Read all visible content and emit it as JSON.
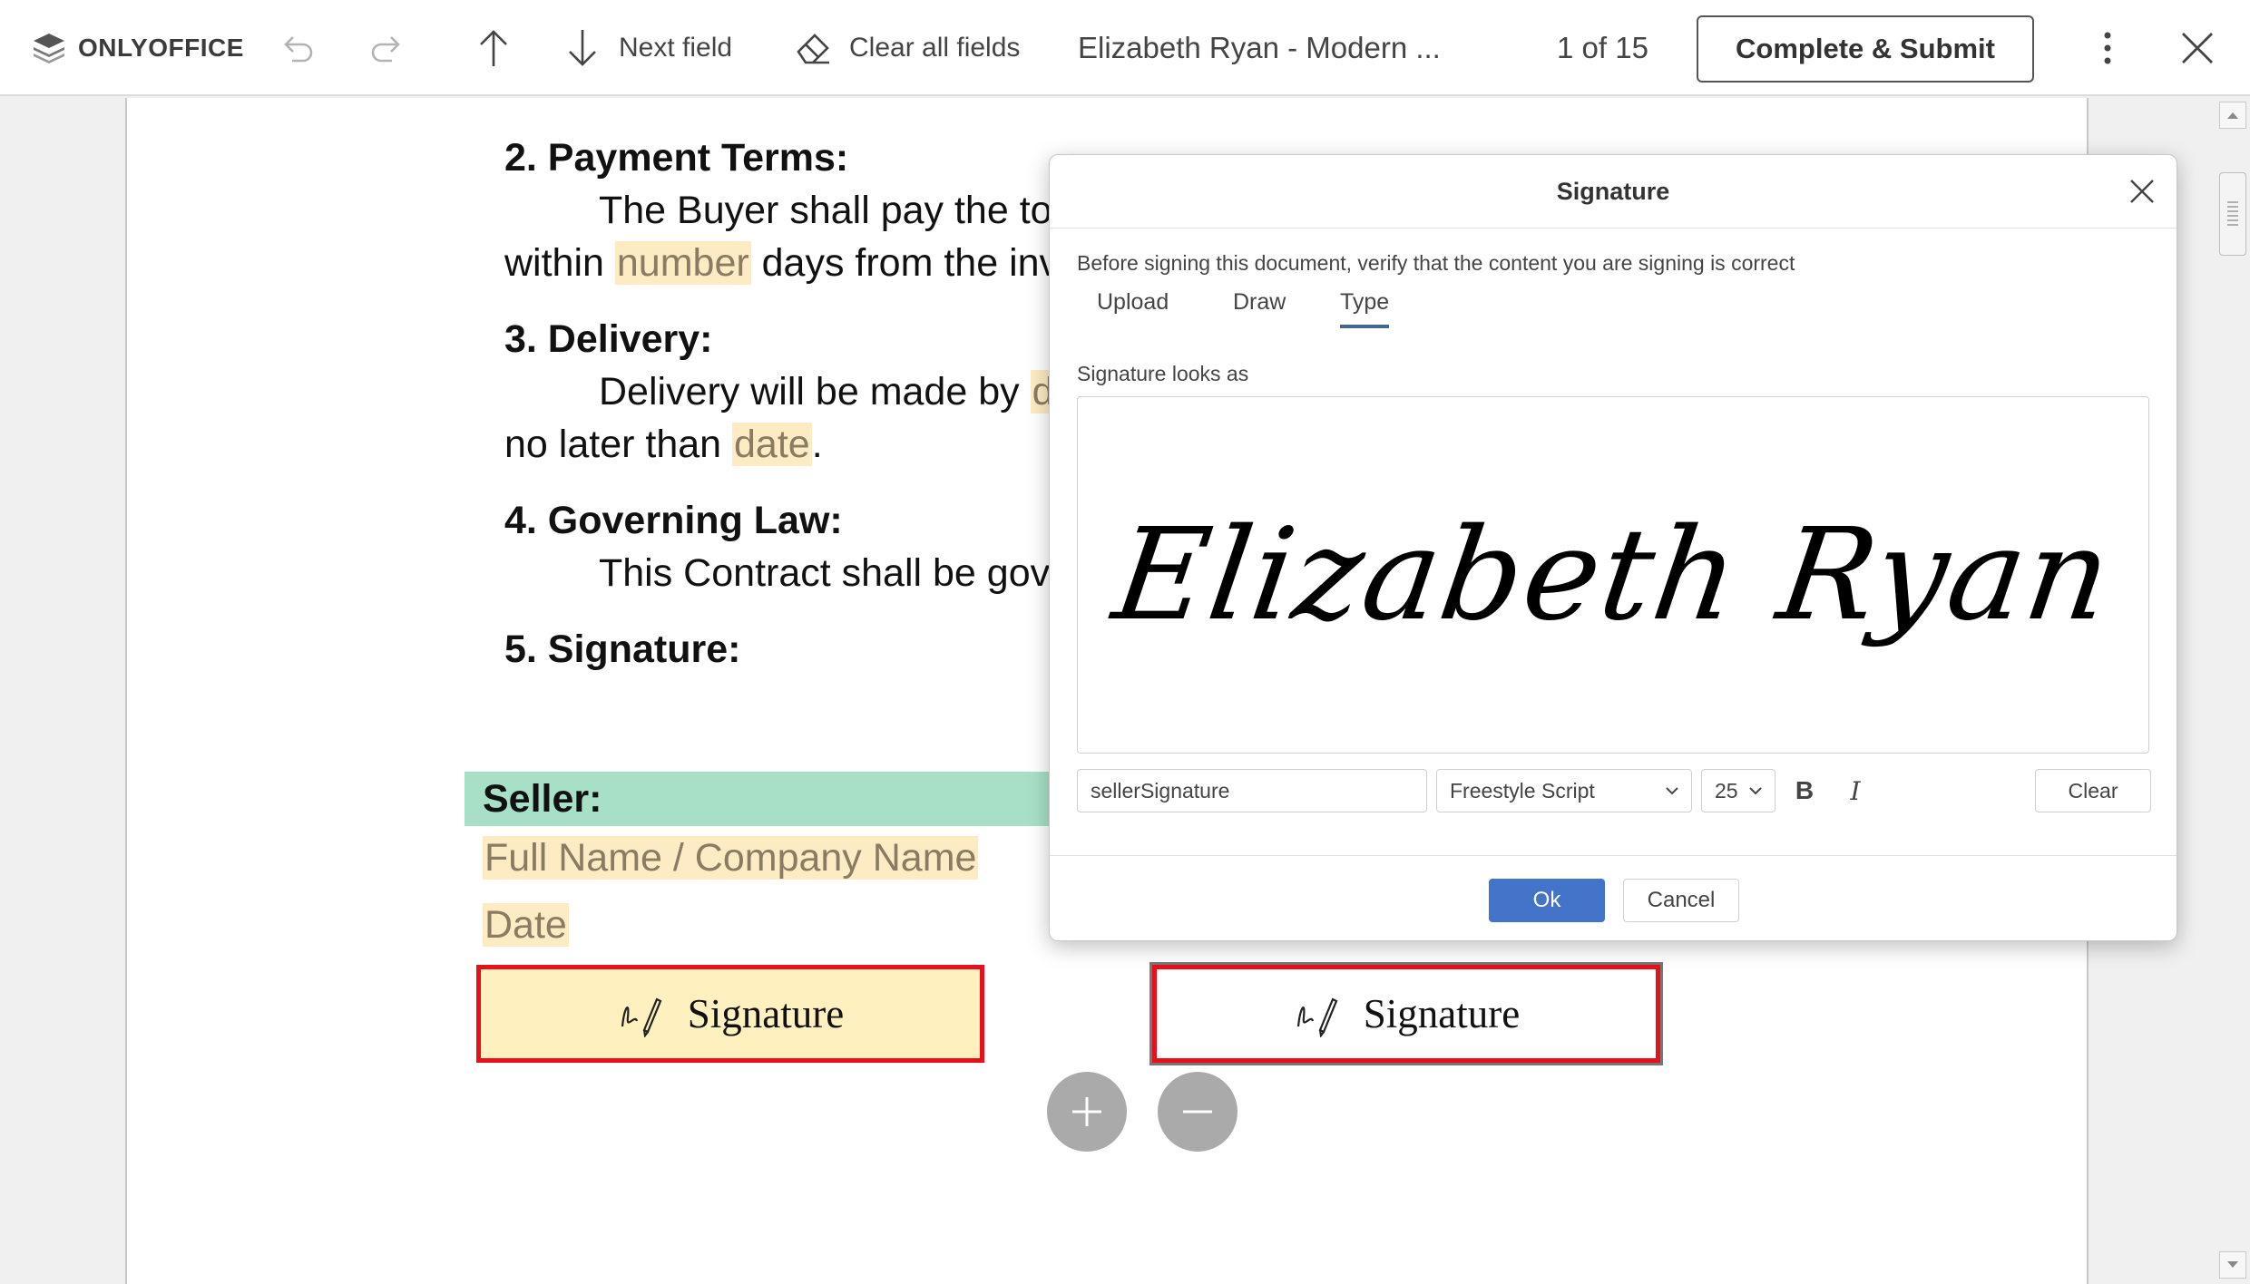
{
  "toolbar": {
    "logo_text": "ONLYOFFICE",
    "next_field_label": "Next field",
    "clear_all_label": "Clear all fields",
    "doc_title": "Elizabeth Ryan - Modern ...",
    "page_indicator": "1 of 15",
    "submit_label": "Complete & Submit"
  },
  "document": {
    "payment_heading": "2. Payment Terms:",
    "payment_line1": "The Buyer shall pay the to",
    "payment_line2_pre": "within ",
    "payment_line2_field": "number",
    "payment_line2_post": " days from the inv",
    "delivery_heading": "3. Delivery:",
    "delivery_line1": "Delivery will be made by",
    "delivery_line1_field": "d",
    "delivery_line2_pre": "no later than ",
    "delivery_line2_field": "date",
    "delivery_line2_post": ".",
    "law_heading": "4. Governing Law:",
    "law_line1": "This Contract shall be gov",
    "signature_heading": "5. Signature:",
    "seller_label": "Seller:",
    "full_name_field": "Full Name / Company Name",
    "date_field": "Date",
    "signature_field_1": "Signature",
    "signature_field_2": "Signature"
  },
  "dialog": {
    "title": "Signature",
    "note": "Before signing this document, verify that the content you are signing is correct",
    "tabs": [
      {
        "label": "Upload",
        "active": false
      },
      {
        "label": "Draw",
        "active": false
      },
      {
        "label": "Type",
        "active": true
      }
    ],
    "looks_as_label": "Signature looks as",
    "preview_text": "Elizabeth Ryan",
    "name_input_value": "sellerSignature",
    "font_value": "Freestyle Script",
    "size_value": "25",
    "bold_label": "B",
    "italic_label": "I",
    "clear_label": "Clear",
    "ok_label": "Ok",
    "cancel_label": "Cancel"
  },
  "colors": {
    "accent": "#4473ca",
    "tab_underline": "#446995",
    "field_highlight": "#fdebc4",
    "seller_band": "#a8e0c7",
    "signature_border": "#e8101a"
  }
}
